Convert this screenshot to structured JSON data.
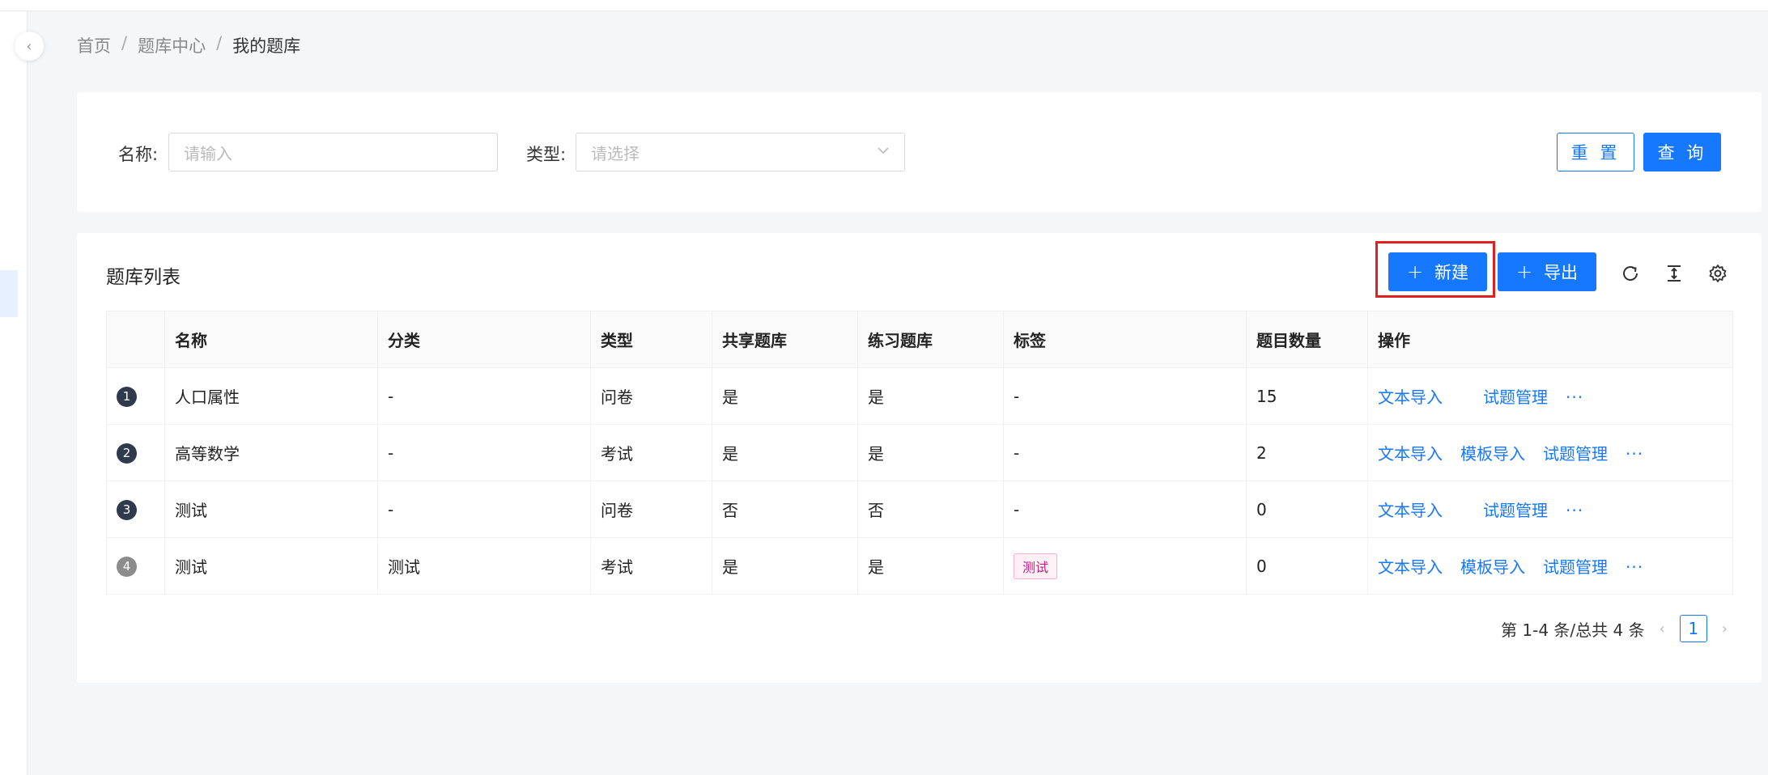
{
  "breadcrumb": [
    "首页",
    "题库中心",
    "我的题库"
  ],
  "search": {
    "name_label": "名称:",
    "name_placeholder": "请输入",
    "type_label": "类型:",
    "type_placeholder": "请选择",
    "reset_label": "重 置",
    "query_label": "查 询"
  },
  "list": {
    "title": "题库列表",
    "new_label": "新建",
    "export_label": "导出",
    "columns": [
      "",
      "名称",
      "分类",
      "类型",
      "共享题库",
      "练习题库",
      "标签",
      "题目数量",
      "操作"
    ],
    "rows": [
      {
        "index": "1",
        "name": "人口属性",
        "category": "-",
        "type": "问卷",
        "shared": "是",
        "practice": "是",
        "tag": "-",
        "count": "15",
        "actions": [
          "文本导入",
          "试题管理"
        ]
      },
      {
        "index": "2",
        "name": "高等数学",
        "category": "-",
        "type": "考试",
        "shared": "是",
        "practice": "是",
        "tag": "-",
        "count": "2",
        "actions": [
          "文本导入",
          "模板导入",
          "试题管理"
        ]
      },
      {
        "index": "3",
        "name": "测试",
        "category": "-",
        "type": "问卷",
        "shared": "否",
        "practice": "否",
        "tag": "-",
        "count": "0",
        "actions": [
          "文本导入",
          "试题管理"
        ]
      },
      {
        "index": "4",
        "name": "测试",
        "category": "测试",
        "type": "考试",
        "shared": "是",
        "practice": "是",
        "tag": "测试",
        "count": "0",
        "actions": [
          "文本导入",
          "模板导入",
          "试题管理"
        ]
      }
    ],
    "more_label": "···",
    "pagination_text": "第 1-4 条/总共 4 条",
    "current_page": "1"
  },
  "colors": {
    "primary": "#1677ff",
    "highlight": "#e02020",
    "tag": "#c41d7f"
  },
  "icons": [
    "chevron-left-icon",
    "chevron-down-icon",
    "plus-icon",
    "refresh-icon",
    "column-height-icon",
    "settings-icon"
  ]
}
